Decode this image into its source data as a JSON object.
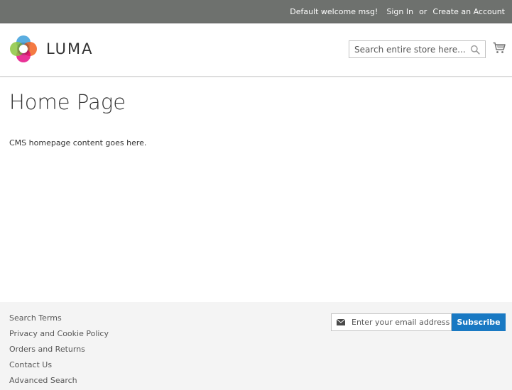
{
  "topbar": {
    "welcome": "Default welcome msg!",
    "sign_in": "Sign In",
    "or": "or",
    "create_account": "Create an Account"
  },
  "header": {
    "logo_text": "LUMA",
    "search_placeholder": "Search entire store here...",
    "search_value": ""
  },
  "main": {
    "title": "Home Page",
    "content": "CMS homepage content goes here."
  },
  "footer": {
    "links": [
      "Search Terms",
      "Privacy and Cookie Policy",
      "Orders and Returns",
      "Contact Us",
      "Advanced Search"
    ],
    "newsletter": {
      "placeholder": "Enter your email address",
      "value": "",
      "subscribe_label": "Subscribe"
    }
  },
  "colors": {
    "topbar_bg": "#6e716e",
    "accent": "#1979c3",
    "footer_bg": "#f4f4f4"
  },
  "icons": [
    "luma-logo-icon",
    "search-icon",
    "cart-icon",
    "envelope-icon"
  ]
}
